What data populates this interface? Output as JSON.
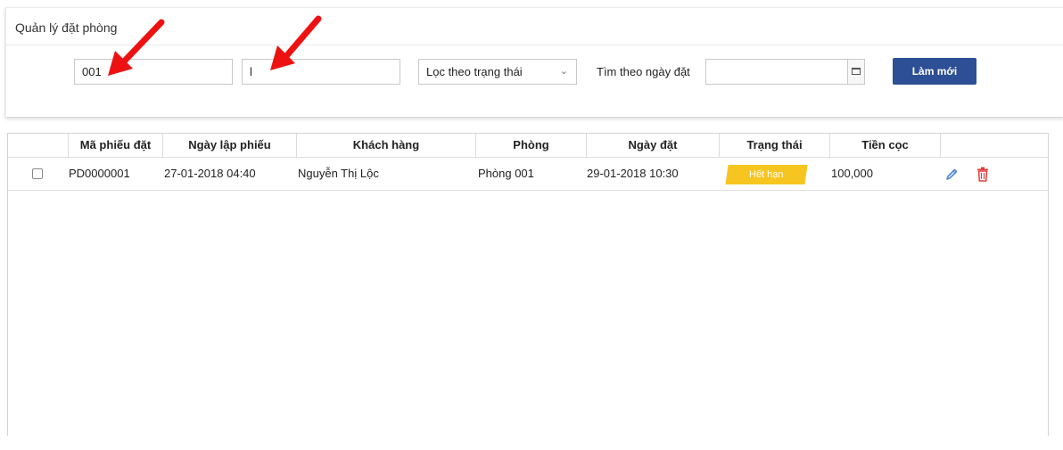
{
  "header": {
    "title": "Quản lý đặt phòng"
  },
  "filters": {
    "code_value": "001",
    "customer_value": "l",
    "status_select": "Lọc theo trạng thái",
    "date_label": "Tìm theo ngày đặt",
    "date_value": "",
    "refresh_label": "Làm mới"
  },
  "icons": {
    "calendar": "calendar-icon",
    "select_arrow": "chevron-down-icon",
    "edit": "pencil-icon",
    "delete": "trash-icon",
    "annotation": "red-arrow-icon"
  },
  "colors": {
    "primary_button": "#2d4f95",
    "status_expired": "#f7c520",
    "edit_icon": "#4f86d6",
    "delete_icon": "#e23b3b",
    "annotation_arrow": "#ee1111"
  },
  "table": {
    "columns": [
      "Mã phiếu đặt",
      "Ngày lập phiếu",
      "Khách hàng",
      "Phòng",
      "Ngày đặt",
      "Trạng thái",
      "Tiền cọc"
    ],
    "rows": [
      {
        "code": "PD0000001",
        "created": "27-01-2018 04:40",
        "customer": "Nguyễn Thị Lộc",
        "room": "Phòng 001",
        "booked": "29-01-2018 10:30",
        "status": "Hết hạn",
        "deposit": "100,000"
      }
    ]
  }
}
